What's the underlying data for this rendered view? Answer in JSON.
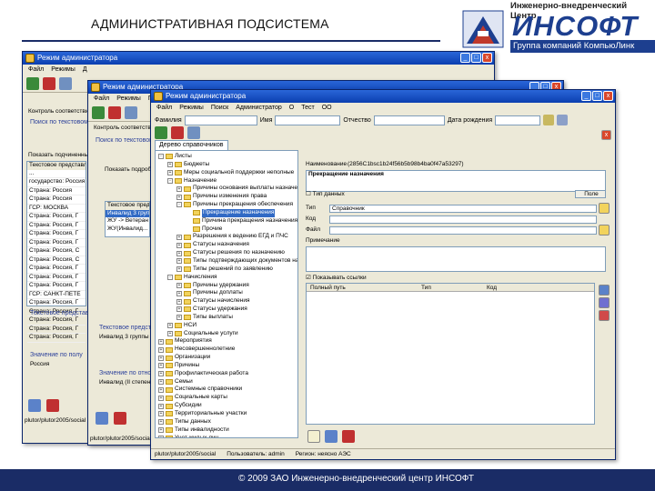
{
  "slide": {
    "title": "АДМИНИСТРАТИВНАЯ ПОДСИСТЕМА",
    "logo_tagline": "Инженерно-внедренческий Центр",
    "logo_brand": "ИНСОФТ",
    "logo_group": "Группа компаний КомпьюЛинк",
    "footer": "© 2009 ЗАО Инженерно-внедренческий центр ИНСОФТ"
  },
  "window_title": "Режим администратора",
  "menu_short": [
    "Файл",
    "Режимы",
    "Д"
  ],
  "menu_mid": [
    "Файл",
    "Режимы",
    "Поиск",
    "Администратор",
    "О",
    "Тест",
    "ОО"
  ],
  "menu_front": [
    "Файл",
    "Режимы",
    "Поиск",
    "Администратор",
    "О",
    "Тест",
    "ОО"
  ],
  "back1": {
    "filter_label": "Контроль соответствия",
    "hint": "Поиск по текстовому представлению",
    "checkbox": "Показать подчиненные",
    "col_header": "Текстовое представление",
    "rows": [
      "...",
      "государство: Россия",
      "Страна: Россия",
      "Страна: Россия",
      "ГСР: МОСКВА",
      "Страна: Россия, Г",
      "Страна: Россия, Г",
      "Страна: Россия, Г",
      "Страна: Россия, Г",
      "Страна: Россия, С",
      "Страна: Россия, С",
      "Страна: Россия, Г",
      "Страна: Россия, Г",
      "Страна: Россия, Г",
      "ГСР: САНКТ-ПЕТЕ",
      "Страна: Россия, Г",
      "Страна: Россия, Г",
      "Страна: Россия, Г",
      "Страна: Россия, Г",
      "Страна: Россия, Г"
    ],
    "lower_hint": "Текстовое представление",
    "address_label": "Значение по полу",
    "address_value": "Россия",
    "path": "plutor/plutor2005/social"
  },
  "back2": {
    "filter_label": "Контроль соответствия",
    "hint": "Поиск по текстовому представлению",
    "checkbox": "Показать подробно",
    "col_header": "Текстовое представление",
    "rows": [
      "Инвалид 3 группы",
      "ЖУ -> Ветеран",
      "ЖУ(Инвалид..."
    ],
    "lower_hint": "Текстовое представление",
    "lower_value": "Инвалид 3 группы",
    "lower_hint2": "Значение по отношению",
    "lower_value2": "Инвалид (II степени)",
    "path": "plutor/plutor2005/social"
  },
  "front": {
    "search_labels": [
      "Фамилия",
      "Имя",
      "Отчество",
      "Дата рождения"
    ],
    "tab_label": "Дерево справочников",
    "tree": [
      {
        "depth": 0,
        "exp": "-",
        "label": "Листы"
      },
      {
        "depth": 1,
        "exp": "+",
        "label": "Бюджеты"
      },
      {
        "depth": 1,
        "exp": "+",
        "label": "Меры социальной поддержки неполные"
      },
      {
        "depth": 1,
        "exp": "-",
        "label": "Назначение"
      },
      {
        "depth": 2,
        "exp": "+",
        "label": "Причины основания выплаты назначения"
      },
      {
        "depth": 2,
        "exp": "+",
        "label": "Причины изменения права"
      },
      {
        "depth": 2,
        "exp": "-",
        "label": "Причины прекращения обеспечения"
      },
      {
        "depth": 3,
        "exp": "",
        "label": "Прекращение назначения",
        "selected": true
      },
      {
        "depth": 3,
        "exp": "",
        "label": "Причина прекращения назначения"
      },
      {
        "depth": 3,
        "exp": "",
        "label": "Прочие"
      },
      {
        "depth": 2,
        "exp": "+",
        "label": "Разрешения к ведению ЕГД и ПЧС"
      },
      {
        "depth": 2,
        "exp": "+",
        "label": "Статусы назначения"
      },
      {
        "depth": 2,
        "exp": "+",
        "label": "Статусы решения по назначению"
      },
      {
        "depth": 2,
        "exp": "+",
        "label": "Типы подтверждающих документов на заявление"
      },
      {
        "depth": 2,
        "exp": "+",
        "label": "Типы решений по заявлению"
      },
      {
        "depth": 1,
        "exp": "-",
        "label": "Начисления"
      },
      {
        "depth": 2,
        "exp": "+",
        "label": "Причины удержания"
      },
      {
        "depth": 2,
        "exp": "+",
        "label": "Причины доплаты"
      },
      {
        "depth": 2,
        "exp": "+",
        "label": "Статусы начисления"
      },
      {
        "depth": 2,
        "exp": "+",
        "label": "Статусы удержания"
      },
      {
        "depth": 2,
        "exp": "+",
        "label": "Типы выплаты"
      },
      {
        "depth": 1,
        "exp": "+",
        "label": "НСИ"
      },
      {
        "depth": 1,
        "exp": "+",
        "label": "Социальные услуги"
      },
      {
        "depth": 0,
        "exp": "+",
        "label": "Мероприятия"
      },
      {
        "depth": 0,
        "exp": "+",
        "label": "Несовершеннолетние"
      },
      {
        "depth": 0,
        "exp": "+",
        "label": "Организации"
      },
      {
        "depth": 0,
        "exp": "+",
        "label": "Причины"
      },
      {
        "depth": 0,
        "exp": "+",
        "label": "Профилактическая работа"
      },
      {
        "depth": 0,
        "exp": "+",
        "label": "Семьи"
      },
      {
        "depth": 0,
        "exp": "+",
        "label": "Системные справочники"
      },
      {
        "depth": 0,
        "exp": "+",
        "label": "Социальные карты"
      },
      {
        "depth": 0,
        "exp": "+",
        "label": "Субсидии"
      },
      {
        "depth": 0,
        "exp": "+",
        "label": "Территориальные участки"
      },
      {
        "depth": 0,
        "exp": "+",
        "label": "Типы данных"
      },
      {
        "depth": 0,
        "exp": "+",
        "label": "Типы инвалидности"
      },
      {
        "depth": 0,
        "exp": "+",
        "label": "Учет жилых лиц"
      },
      {
        "depth": 0,
        "exp": "+",
        "label": "Учет льгот"
      }
    ],
    "detail": {
      "name_label": "Наименование",
      "guid": "(2856C1bsc1b24f56b5b98b4ba0f47a53297)",
      "name_value": "Прекращение назначения",
      "checkbox_label": "Тип данных",
      "type_btn": "Поле",
      "type_label": "Тип",
      "type_value": "Справочник",
      "code_label": "Код",
      "file_label": "Файл",
      "note_label": "Примечание",
      "refs_checkbox": "Показывать ссылки",
      "grid_cols": [
        "Полный путь",
        "Тип",
        "Код"
      ]
    },
    "status": [
      "plutor/plutor2005/social",
      "Пользователь: admin",
      "Регион: неясно АЭС"
    ]
  }
}
